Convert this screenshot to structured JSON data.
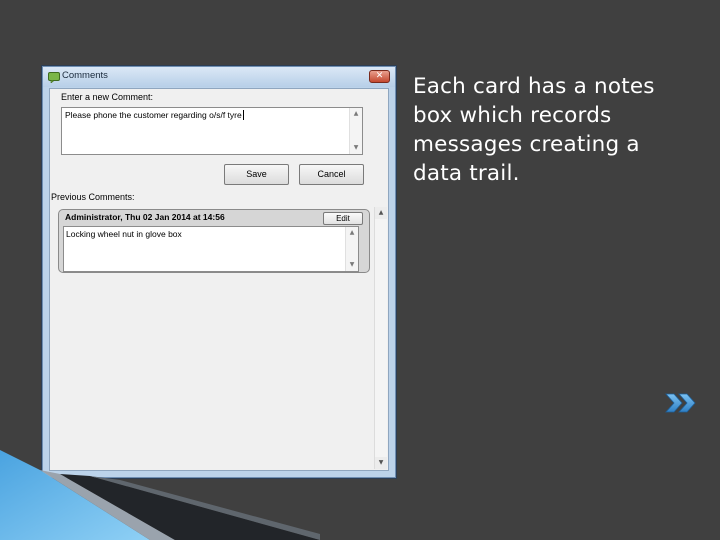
{
  "slide": {
    "text_lines": [
      "Each card has a notes",
      "box which records",
      "messages creating a",
      "data trail."
    ],
    "next_icon": "double-chevron-right-icon",
    "accent_color": "#3c8fd1"
  },
  "dialog": {
    "title": "Comments",
    "close_icon": "close-icon",
    "new_comment_label": "Enter a new Comment:",
    "new_comment_value": "Please phone the customer regarding o/s/f tyre",
    "save_label": "Save",
    "cancel_label": "Cancel",
    "previous_label": "Previous Comments:",
    "previous_comments": [
      {
        "header": "Administrator, Thu 02 Jan 2014 at 14:56",
        "edit_label": "Edit",
        "body": "Locking wheel nut in glove box"
      }
    ]
  }
}
